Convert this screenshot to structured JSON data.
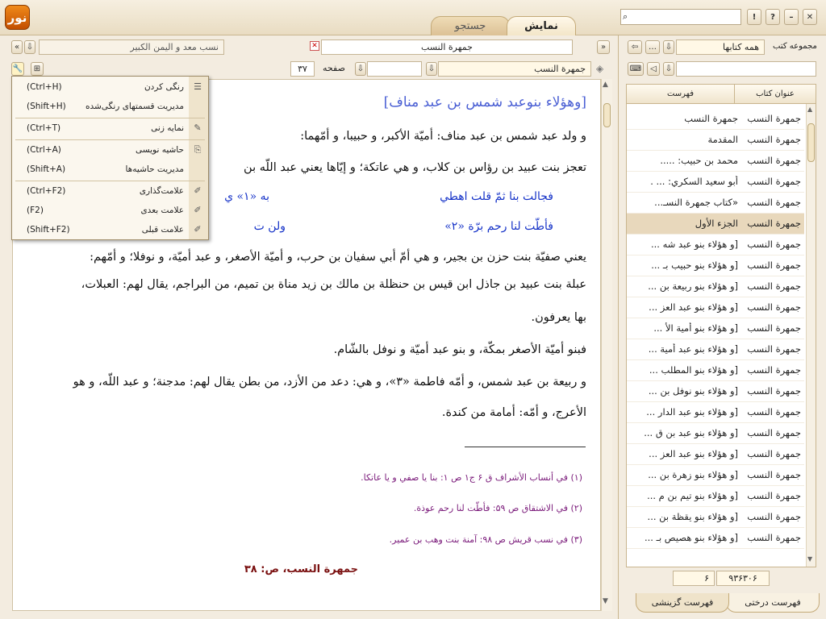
{
  "app": {
    "logo_text": "نور"
  },
  "tabs": {
    "show": "نمایش",
    "search": "جستجو"
  },
  "window_buttons": {
    "close": "✕",
    "minimize": "–",
    "help": "?",
    "alert": "!"
  },
  "search_placeholder": "",
  "doc_tabs": {
    "active": "جمهرة النسب",
    "inactive": "نسب معد و اليمن الكبير"
  },
  "nav": {
    "book": "جمهرة النسب",
    "page_label": "صفحه",
    "page_value": "۳۷",
    "page_field": ""
  },
  "menu": {
    "items": [
      {
        "label": "رنگی کردن",
        "shortcut": "(Ctrl+H)"
      },
      {
        "label": "مدیریت قسمتهای رنگی‌شده",
        "shortcut": "(Shift+H)"
      },
      {
        "label": "نمایه زنی",
        "shortcut": "(Ctrl+T)"
      },
      {
        "label": "حاشیه نویسی",
        "shortcut": "(Ctrl+A)"
      },
      {
        "label": "مدیریت حاشیه‌ها",
        "shortcut": "(Shift+A)"
      },
      {
        "label": "علامت‌گذاری",
        "shortcut": "(Ctrl+F2)"
      },
      {
        "label": "علامت بعدی",
        "shortcut": "(F2)"
      },
      {
        "label": "علامت قبلی",
        "shortcut": "(Shift+F2)"
      }
    ]
  },
  "content": {
    "heading": "[وهؤلاء بنوعبد شمس بن عبد مناف]",
    "lines": [
      "و ولد عبد شمس بن عبد مناف: أميّة الأكبر، و حبيبا، و أمّهما:",
      "تعجز بنت عبيد بن رؤاس بن كلاب، و هي عاتكة؛ و إيّاها يعني عبد اللّه بن",
      "يعني صفيّة بنت حزن بن بجير، و هي أمّ أبي سفيان بن حرب، و أميّة الأصغر، و عبد أميّة، و نوفلا؛ و أمّهم:",
      "عبلة بنت عبيد بن جاذل ابن قيس بن حنظلة بن مالك بن زيد مناة بن تميم، من البراجم، يقال لهم: العبلات،",
      "بها يعرفون.",
      "فبنو أميّة الأصغر بمكّة، و بنو عبد أميّة و نوفل بالشّام.",
      "و ربيعة بن عبد شمس، و أمّه فاطمة «۳»، و هي: دعد من الأزد، من بطن يقال لهم: مدجنة؛ و عبد اللّه، و هو",
      "الأعرج، و أمّه: أمامة من كندة."
    ],
    "poem": [
      {
        "right": "فجالت بنا ثمّ قلت اهطي",
        "left": "به «۱» ي"
      },
      {
        "right": "فأطّت لنا رحم برّة «۲»",
        "left": "ولن ت"
      }
    ],
    "footnotes": [
      "(۱) في أنساب الأشراف ق ۶ ج۱ ص ۱: بنا يا صفي و يا عاتكا.",
      "(۲) في الاشتقاق ص ۵۹: فأطّت لنا رحم عوذة.",
      "(۳) في نسب قريش ص ۹۸: آمنة بنت وهب بن عمير."
    ],
    "page_footer": "جمهرة النسب، ص: ۳۸"
  },
  "right_panel": {
    "collection_label": "مجموعه كتب",
    "collection_value": "همه كتابها",
    "search_value": "",
    "col_title": "عنوان كتاب",
    "col_index": "فهرست",
    "rows": [
      {
        "book": "جمهرة النسب",
        "entry": "جمهرة النسب"
      },
      {
        "book": "جمهرة النسب",
        "entry": "المقدمة"
      },
      {
        "book": "جمهرة النسب",
        "entry": "محمد بن حبيب: ....."
      },
      {
        "book": "جمهرة النسب",
        "entry": "أبو سعيد السكري: ... ."
      },
      {
        "book": "جمهرة النسب",
        "entry": "«كتاب جمهرة النسـ..."
      },
      {
        "book": "جمهرة النسب",
        "entry": "الجزء الأول"
      },
      {
        "book": "جمهرة النسب",
        "entry": "[و هؤلاء بنو عبد شه ..."
      },
      {
        "book": "جمهرة النسب",
        "entry": "[و هؤلاء بنو حبيب بـ ..."
      },
      {
        "book": "جمهرة النسب",
        "entry": "[و هؤلاء بنو ربيعة بن ..."
      },
      {
        "book": "جمهرة النسب",
        "entry": "[و هؤلاء بنو عبد العز ..."
      },
      {
        "book": "جمهرة النسب",
        "entry": "[و هؤلاء بنو أمية الأ ..."
      },
      {
        "book": "جمهرة النسب",
        "entry": "[و هؤلاء بنو عبد أمية ..."
      },
      {
        "book": "جمهرة النسب",
        "entry": "[و هؤلاء بنو المطلب ..."
      },
      {
        "book": "جمهرة النسب",
        "entry": "[و هؤلاء بنو نوفل بن ..."
      },
      {
        "book": "جمهرة النسب",
        "entry": "[و هؤلاء بنو عبد الدار ..."
      },
      {
        "book": "جمهرة النسب",
        "entry": "[و هؤلاء بنو عبد بن ق ..."
      },
      {
        "book": "جمهرة النسب",
        "entry": "[و هؤلاء بنو عبد العز ..."
      },
      {
        "book": "جمهرة النسب",
        "entry": "[و هؤلاء بنو زهرة بن ..."
      },
      {
        "book": "جمهرة النسب",
        "entry": "[و هؤلاء بنو تيم بن م ..."
      },
      {
        "book": "جمهرة النسب",
        "entry": "[و هؤلاء بنو يقظة بن ..."
      },
      {
        "book": "جمهرة النسب",
        "entry": "[و هؤلاء بنو هصيص بـ ..."
      }
    ],
    "selected_row": 5,
    "count_left": "۶",
    "count_right": "۹۳۶۳۰۶",
    "tab_tree": "فهرست درختی",
    "tab_select": "فهرست گزینشی"
  }
}
